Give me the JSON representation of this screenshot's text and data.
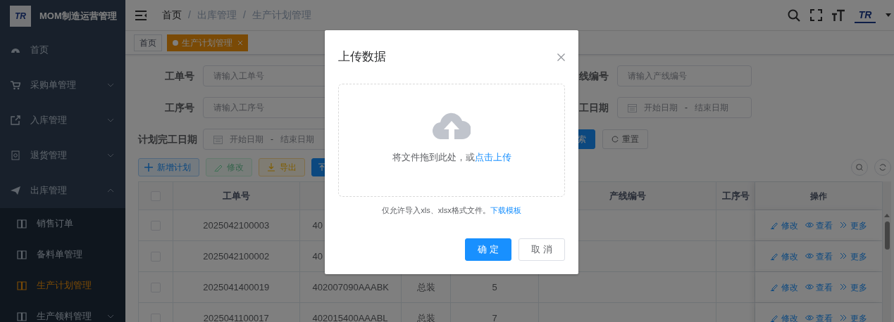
{
  "sidebar": {
    "logo_text": "TR",
    "title": "MOM制造运营管理",
    "items": [
      {
        "label": "首页",
        "selected": false
      },
      {
        "label": "采购单管理",
        "selected": false,
        "expanded": false
      },
      {
        "label": "入库管理",
        "selected": false,
        "expanded": false
      },
      {
        "label": "退货管理",
        "selected": false,
        "expanded": false
      },
      {
        "label": "出库管理",
        "selected": false,
        "expanded": true,
        "children": [
          {
            "label": "销售订单",
            "selected": false
          },
          {
            "label": "备料单管理",
            "selected": false
          },
          {
            "label": "生产计划管理",
            "selected": true
          },
          {
            "label": "生产领料管理",
            "selected": false,
            "expanded": false
          }
        ]
      }
    ]
  },
  "header": {
    "breadcrumb": [
      {
        "label": "首页"
      },
      {
        "separator": "/",
        "label": "出库管理"
      },
      {
        "separator": "/",
        "label": "生产计划管理"
      }
    ],
    "avatar_logo_text": "TR"
  },
  "tags": [
    {
      "label": "首页",
      "selected": false
    },
    {
      "label": "生产计划管理",
      "selected": true
    }
  ],
  "filter_rows": [
    [
      {
        "kind": "text",
        "label": "工单号",
        "placeholder": "请输入工单号"
      },
      {
        "kind": "text",
        "label": "线编号",
        "placeholder": "请输入产线编号"
      }
    ],
    [
      {
        "kind": "text",
        "label": "工序号",
        "placeholder": "请输入工序号"
      },
      {
        "kind": "daterange",
        "label": "工日期",
        "start_placeholder": "开始日期",
        "separator": "-",
        "end_placeholder": "结束日期"
      }
    ],
    [
      {
        "kind": "daterange",
        "label": "计划完工日期",
        "start_placeholder": "开始日期",
        "separator": "-",
        "end_placeholder": "结束日期"
      }
    ]
  ],
  "search_buttons": [
    {
      "kind": "search",
      "label": "索"
    },
    {
      "kind": "reset",
      "label": "重置"
    }
  ],
  "toolbar": [
    {
      "kind": "add",
      "label": "新增计划",
      "disabled": false
    },
    {
      "kind": "edit",
      "label": "修改",
      "disabled": true
    },
    {
      "kind": "export",
      "label": "导出",
      "disabled": false
    },
    {
      "kind": "import",
      "disabled": false
    }
  ],
  "table": {
    "select_all_checked": false,
    "columns": [
      "工单号",
      "产线编号",
      "工序号",
      "操作"
    ],
    "rows": [
      {
        "checked": false,
        "work_order": "2025042100003",
        "column_3": "40",
        "actions": [
          {
            "kind": "edit",
            "label": "修改"
          },
          {
            "kind": "view",
            "label": "查看"
          },
          {
            "kind": "more",
            "label": "更多"
          }
        ]
      },
      {
        "checked": false,
        "work_order": "2025042100002",
        "column_3": "40",
        "actions": [
          {
            "kind": "edit",
            "label": "修改"
          },
          {
            "kind": "view",
            "label": "查看"
          },
          {
            "kind": "more",
            "label": "更多"
          }
        ]
      },
      {
        "checked": false,
        "work_order": "2025041400019",
        "column_3": "402007090AAABK",
        "column_4": "总装",
        "column_5": "5",
        "actions": [
          {
            "kind": "edit",
            "label": "修改"
          },
          {
            "kind": "view",
            "label": "查看"
          },
          {
            "kind": "more",
            "label": "更多"
          }
        ]
      },
      {
        "checked": false,
        "work_order": "2025041100017",
        "column_3": "402015400AAABL",
        "column_4": "总装",
        "column_5": "7",
        "actions": [
          {
            "kind": "edit",
            "label": "修改"
          },
          {
            "kind": "view",
            "label": "查看"
          },
          {
            "kind": "more",
            "label": "更多"
          }
        ]
      }
    ]
  },
  "dialog": {
    "title": "上传数据",
    "drop_text": "将文件拖到此处，或",
    "drop_link": "点击上传",
    "hint": "仅允许导入xls、xlsx格式文件。",
    "hint_link": "下载模板",
    "buttons": [
      {
        "kind": "primary",
        "label": "确 定"
      },
      {
        "kind": "default",
        "label": "取 消"
      }
    ]
  }
}
